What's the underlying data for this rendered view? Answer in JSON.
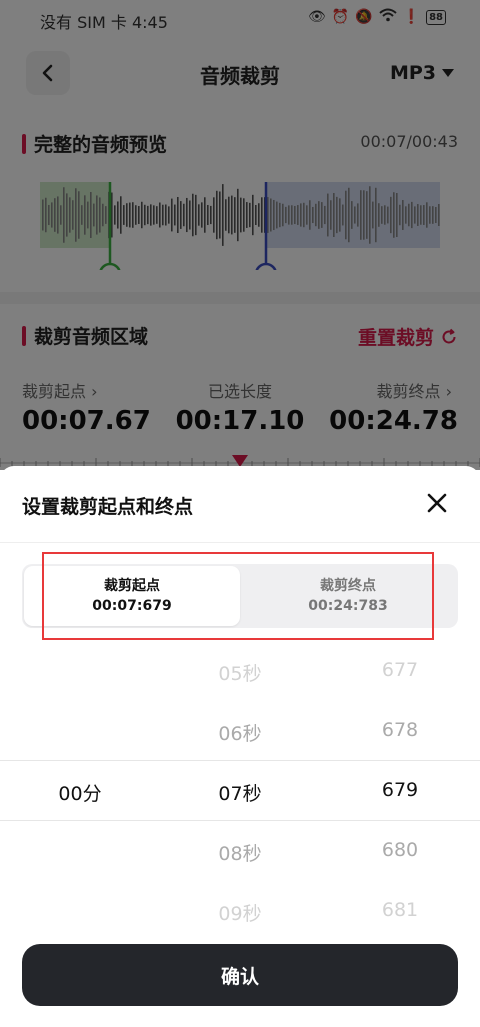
{
  "status_bar": {
    "carrier_time": "没有 SIM 卡 4:45",
    "battery": "88"
  },
  "header": {
    "title": "音频裁剪",
    "format": "MP3"
  },
  "preview": {
    "title": "完整的音频预览",
    "time": "00:07/00:43"
  },
  "crop": {
    "title": "裁剪音频区域",
    "reset_label": "重置裁剪",
    "start_label": "裁剪起点",
    "start_value": "00:07.67",
    "length_label": "已选长度",
    "length_value": "00:17.10",
    "end_label": "裁剪终点",
    "end_value": "00:24.78"
  },
  "sheet": {
    "title": "设置裁剪起点和终点",
    "tabs": [
      {
        "label": "裁剪起点",
        "value": "00:07:679",
        "active": true
      },
      {
        "label": "裁剪终点",
        "value": "00:24:783",
        "active": false
      }
    ],
    "picker": {
      "minutes": {
        "selected": "00分"
      },
      "seconds": {
        "items": [
          "05秒",
          "06秒",
          "07秒",
          "08秒",
          "09秒"
        ],
        "selected_index": 2
      },
      "millis": {
        "items": [
          "677",
          "678",
          "679",
          "680",
          "681"
        ],
        "selected_index": 2
      }
    },
    "confirm_label": "确认"
  },
  "colors": {
    "accent": "#d81b4a",
    "start_marker": "#3cb043",
    "end_marker": "#3b4cc0",
    "confirm_bg": "#24262b",
    "highlight_box": "#e8393a"
  }
}
